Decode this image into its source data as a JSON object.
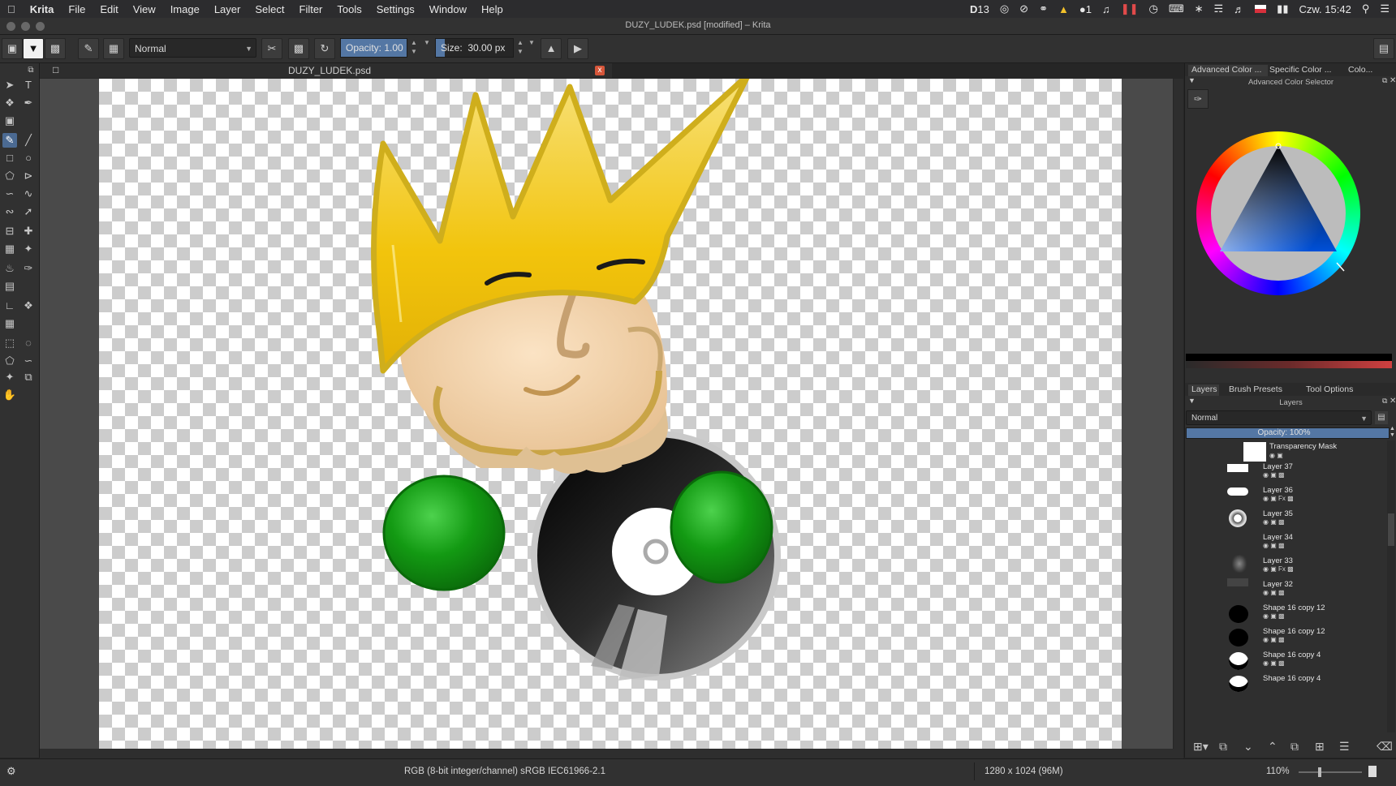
{
  "menubar": {
    "apple": "",
    "app_name": "Krita",
    "items": [
      "File",
      "Edit",
      "View",
      "Image",
      "Layer",
      "Select",
      "Filter",
      "Tools",
      "Settings",
      "Window",
      "Help"
    ],
    "status_items": {
      "badge": "13",
      "notif_count": "1",
      "flag": "PL",
      "clock": "Czw. 15:42"
    }
  },
  "window": {
    "title": "DUZY_LUDEK.psd [modified] – Krita"
  },
  "toolbar": {
    "blend_mode": "Normal",
    "opacity_label": "Opacity:",
    "opacity_value": "1.00",
    "opacity_fraction": 1.0,
    "size_label": "Size:",
    "size_value": "30.00 px",
    "size_fraction": 0.12
  },
  "document": {
    "tab_name": "DUZY_LUDEK.psd",
    "close_glyph": "x"
  },
  "dock": {
    "color_tabs": [
      "Advanced Color ...",
      "Specific Color ...",
      "Colo..."
    ],
    "color_panel_title": "Advanced Color Selector",
    "layer_tabs": [
      "Layers",
      "Brush Presets",
      "Tool Options"
    ],
    "layers_panel_title": "Layers",
    "blend_mode": "Normal",
    "opacity_text": "Opacity:  100%",
    "opacity_fraction": 1.0,
    "layers": [
      {
        "name": "Transparency Mask",
        "icons": ""
      },
      {
        "name": "Layer 37",
        "icons": ""
      },
      {
        "name": "Layer 36",
        "icons": ""
      },
      {
        "name": "Layer 35",
        "icons": "Fx"
      },
      {
        "name": "Layer 34",
        "icons": ""
      },
      {
        "name": "Layer 33",
        "icons": ""
      },
      {
        "name": "Layer 32",
        "icons": "Fx"
      },
      {
        "name": "Shape 16 copy 12",
        "icons": ""
      },
      {
        "name": "Shape 16 copy 12",
        "icons": ""
      },
      {
        "name": "Shape 16 copy 4",
        "icons": ""
      },
      {
        "name": "Shape 16 copy 4",
        "icons": ""
      }
    ]
  },
  "statusbar": {
    "color_profile": "RGB (8-bit integer/channel)  sRGB IEC61966-2.1",
    "image_size": "1280 x 1024 (96M)",
    "zoom": "110%"
  },
  "colors": {
    "accent": "#5477a4",
    "hair": "#f2c40c",
    "glove": "#129a12",
    "skin": "#f0cfa4"
  }
}
